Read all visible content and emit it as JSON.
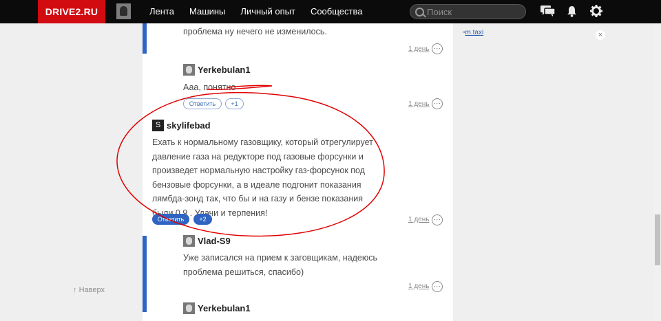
{
  "brand": "DRIVE2.RU",
  "nav": [
    "Лента",
    "Машины",
    "Личный опыт",
    "Сообщества"
  ],
  "search": {
    "placeholder": "Поиск"
  },
  "side": {
    "top_link": "Наверх"
  },
  "ad": {
    "image_alt": "m.taxi",
    "close": "×"
  },
  "comments": {
    "c1": {
      "text": "проблема ну нечего не изменилось.",
      "date": "1 день"
    },
    "c2": {
      "user": "Yerkebulan1",
      "text": "Ааа, понятно",
      "reply": "Ответить",
      "likes": "+1",
      "date": "1 день"
    },
    "c3": {
      "user": "skylifebad",
      "avatar_letter": "S",
      "text": "Ехать к нормальному газовщику, который отрегулирует давление газа на редукторе под газовые форсунки и произведет нормальную настройку газ-форсунок под бензовые форсунки, а в идеале подгонит показания лямбда-зонд так, что бы и на газу и бензе показания были 0,9 . Удачи и терпения!",
      "reply": "Ответить",
      "likes": "+2",
      "date": "1 день"
    },
    "c4": {
      "user": "Vlad-S9",
      "text": "Уже записался на прием к заговщикам, надеюсь проблема решиться, спасибо)",
      "date": "1 день"
    },
    "c5": {
      "user": "Yerkebulan1"
    }
  },
  "more_label": "···",
  "colors": {
    "brand_red": "#d20b11",
    "accent_blue": "#2f64c2",
    "annotation_red": "#e00000"
  }
}
